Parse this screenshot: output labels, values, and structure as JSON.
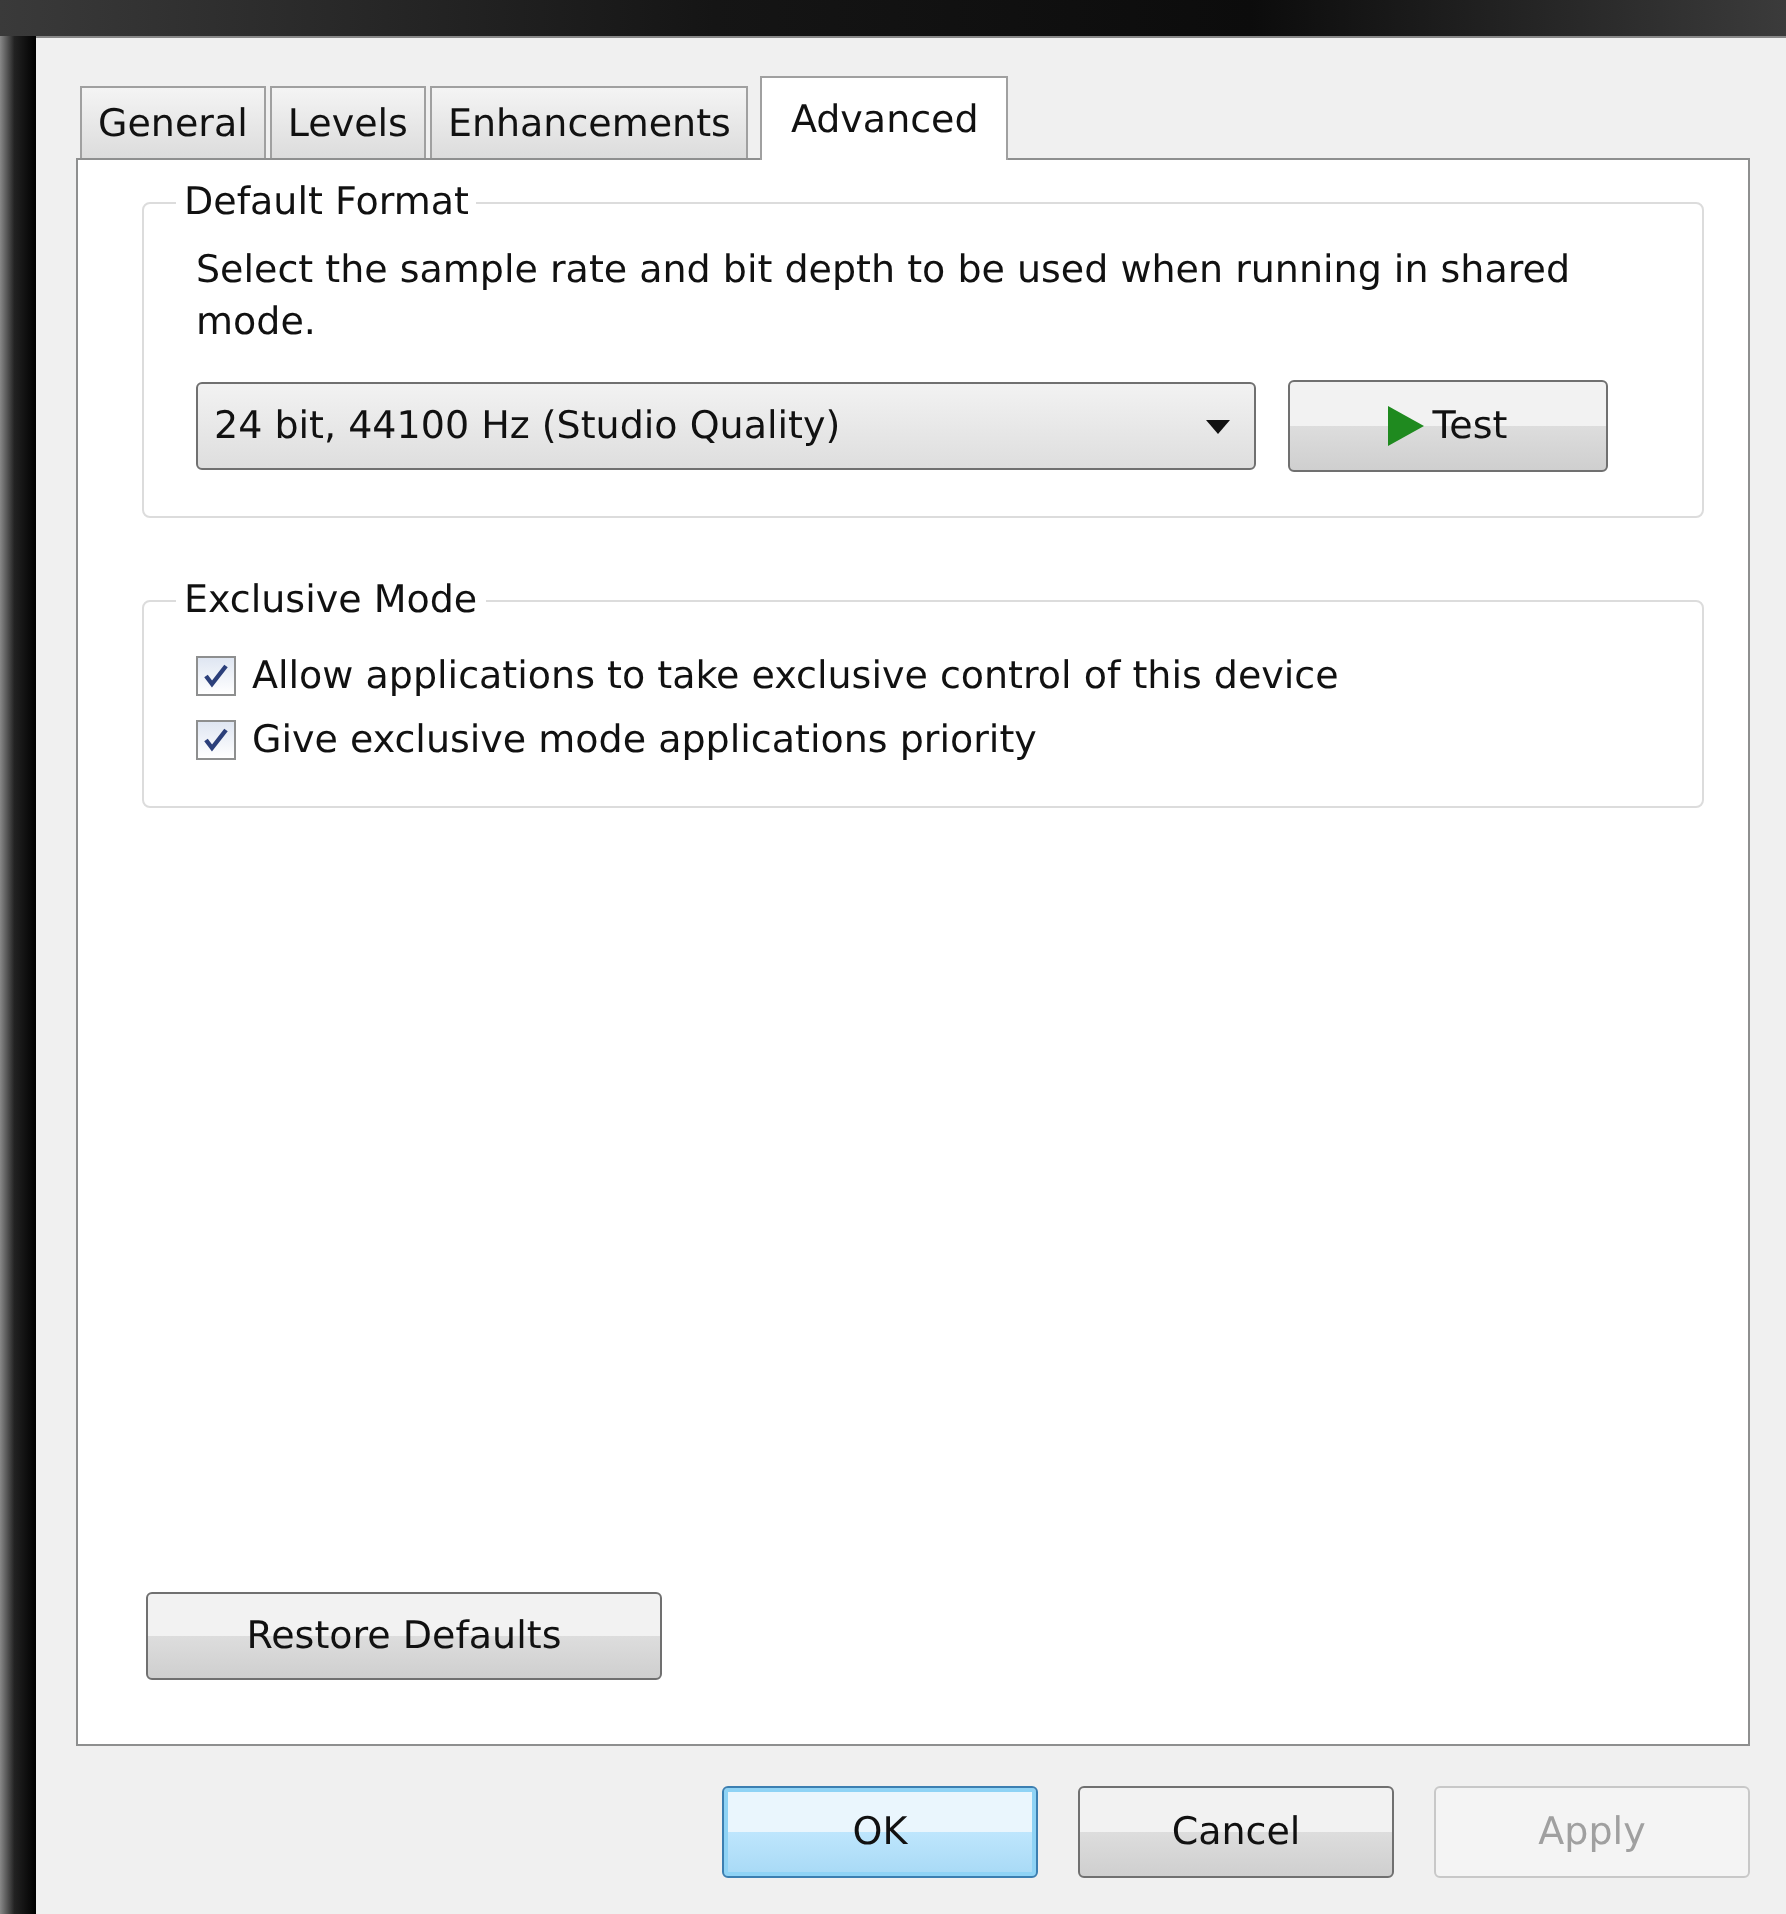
{
  "tabs": [
    {
      "label": "General",
      "selected": false
    },
    {
      "label": "Levels",
      "selected": false
    },
    {
      "label": "Enhancements",
      "selected": false
    },
    {
      "label": "Advanced",
      "selected": true
    }
  ],
  "groups": [
    {
      "kind": "format",
      "title": "Default Format",
      "description": "Select the sample rate and bit depth to be used when running in shared mode.",
      "dropdown": {
        "value": "24 bit, 44100 Hz (Studio Quality)"
      },
      "test_button": "Test"
    },
    {
      "kind": "checks",
      "title": "Exclusive Mode",
      "options": [
        {
          "label": "Allow applications to take exclusive control of this device",
          "checked": true
        },
        {
          "label": "Give exclusive mode applications priority",
          "checked": true
        }
      ]
    }
  ],
  "restore_button": "Restore Defaults",
  "buttons": [
    {
      "label": "OK",
      "default": true,
      "disabled": false
    },
    {
      "label": "Cancel",
      "default": false,
      "disabled": false
    },
    {
      "label": "Apply",
      "default": false,
      "disabled": true
    }
  ]
}
